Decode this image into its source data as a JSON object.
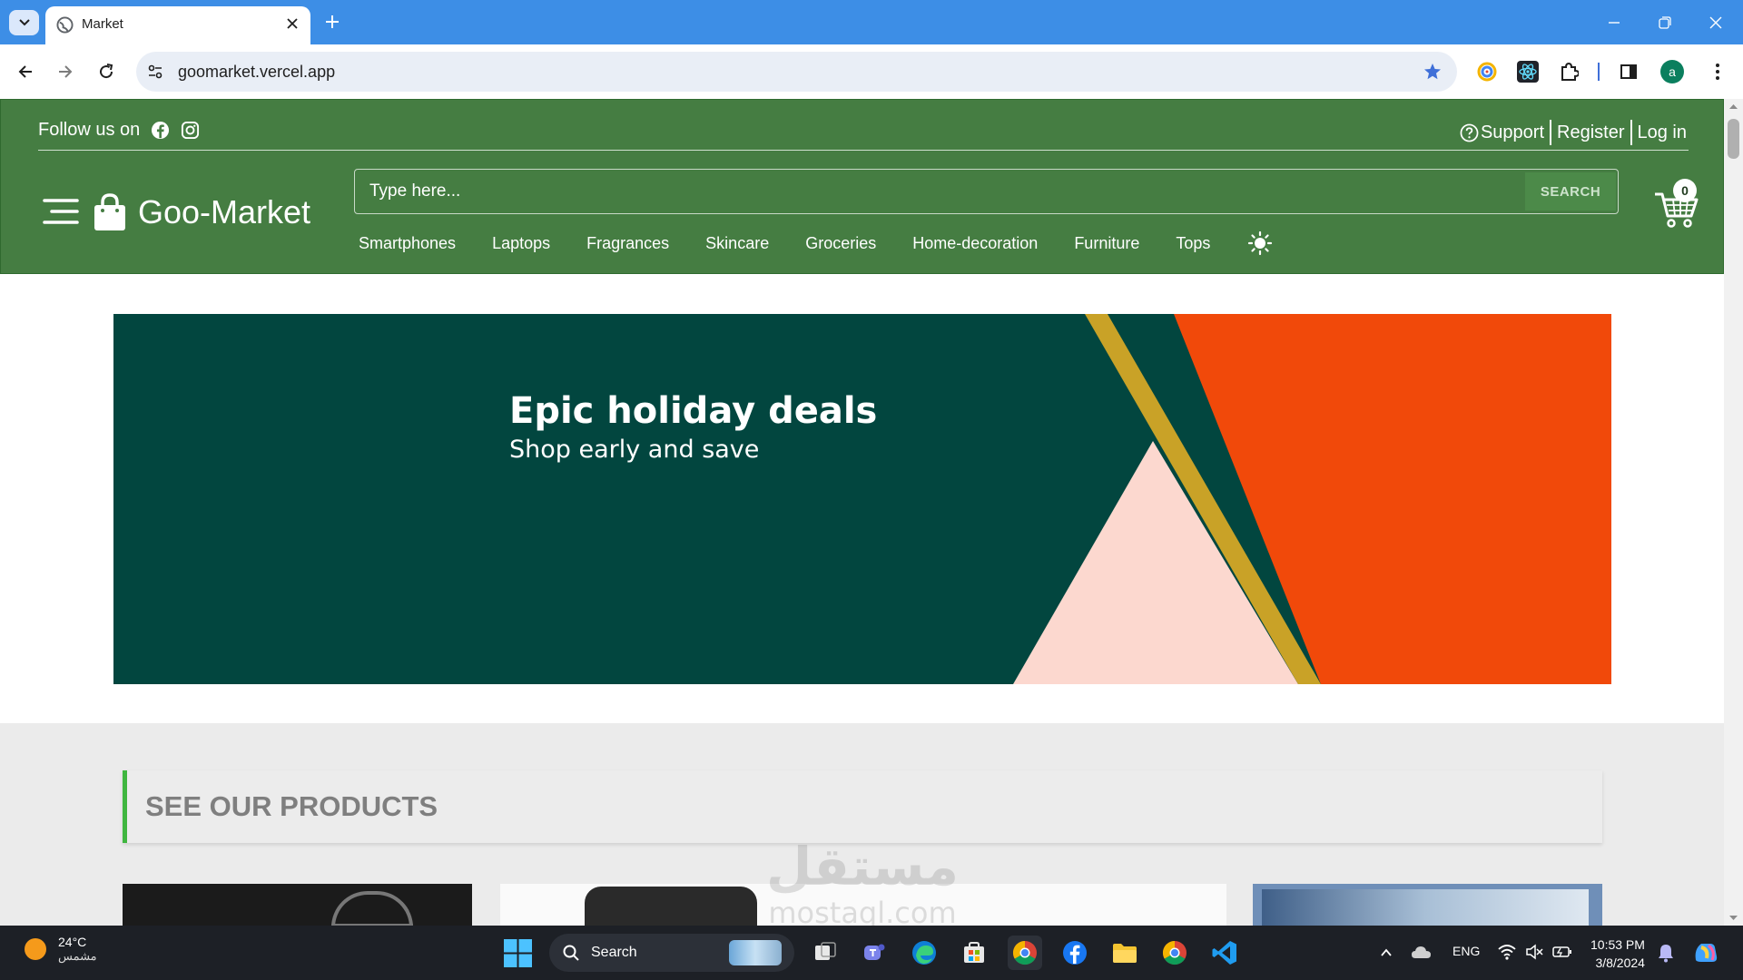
{
  "browser": {
    "tab": {
      "title": "Market"
    },
    "url": "goomarket.vercel.app",
    "profile_initial": "a"
  },
  "site": {
    "follow_label": "Follow us on",
    "top_links": [
      "Support",
      "Register",
      "Log in"
    ],
    "logo_text": "Goo-Market",
    "search": {
      "placeholder": "Type here...",
      "button_label": "SEARCH"
    },
    "cart_count": "0",
    "categories": [
      "Smartphones",
      "Laptops",
      "Fragrances",
      "Skincare",
      "Groceries",
      "Home-decoration",
      "Furniture",
      "Tops"
    ],
    "banner": {
      "title": "Epic holiday deals",
      "subtitle": "Shop early and save"
    },
    "products_heading": "SEE OUR PRODUCTS"
  },
  "colors": {
    "header_green": "#457d42",
    "banner_green": "#02463f",
    "banner_orange": "#f1490a",
    "banner_pink": "#fcd8cf",
    "banner_gold": "#c9a227",
    "heading_accent": "#3fb63f"
  },
  "watermark": {
    "arabic": "مستقل",
    "latin": "mostaql.com"
  },
  "taskbar": {
    "weather": {
      "temp": "24°C",
      "condition": "مشمس"
    },
    "search_label": "Search",
    "language": "ENG",
    "time": "10:53 PM",
    "date": "3/8/2024"
  }
}
